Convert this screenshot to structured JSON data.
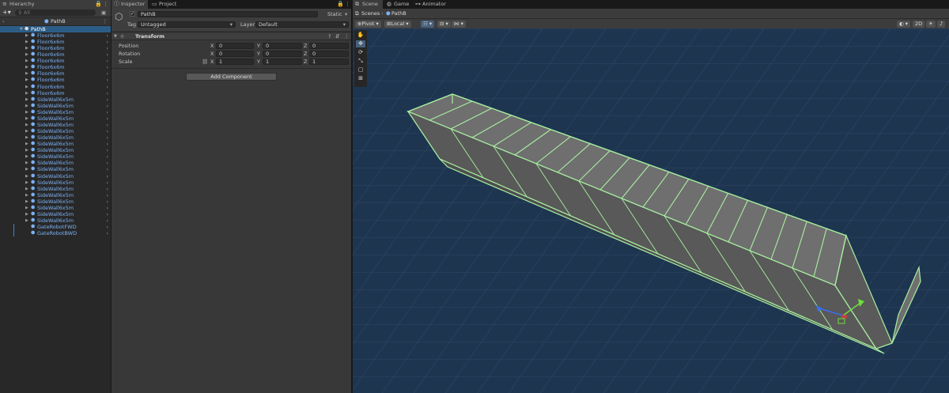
{
  "hierarchy": {
    "tab": "Hierarchy",
    "search_placeholder": "All",
    "scene_name": "PathB",
    "root": "PathB",
    "items": [
      "Floor6x6m",
      "Floor6x6m",
      "Floor6x6m",
      "Floor6x6m",
      "Floor6x6m",
      "Floor6x6m",
      "Floor6x6m",
      "Floor6x6m",
      "Floor6x6m",
      "Floor6x6m",
      "SideWall6x5m",
      "SideWall6x5m",
      "SideWall6x5m",
      "SideWall6x5m",
      "SideWall6x5m",
      "SideWall6x5m",
      "SideWall6x5m",
      "SideWall6x5m",
      "SideWall6x5m",
      "SideWall6x5m",
      "SideWall6x5m",
      "SideWall6x5m",
      "SideWall6x5m",
      "SideWall6x5m",
      "SideWall6x5m",
      "SideWall6x5m",
      "SideWall6x5m",
      "SideWall6x5m",
      "SideWall6x5m",
      "SideWall6x5m",
      "GateRobotFWD",
      "GateRobotBWD"
    ]
  },
  "inspector": {
    "tab": "Inspector",
    "tab2": "Project",
    "object_name": "PathB",
    "static_label": "Static",
    "tag_label": "Tag",
    "tag_value": "Untagged",
    "layer_label": "Layer",
    "layer_value": "Default",
    "component": "Transform",
    "position_label": "Position",
    "rotation_label": "Rotation",
    "scale_label": "Scale",
    "position": {
      "x": "0",
      "y": "0",
      "z": "0"
    },
    "rotation": {
      "x": "0",
      "y": "0",
      "z": "0"
    },
    "scale": {
      "x": "1",
      "y": "1",
      "z": "1"
    },
    "axis_x": "X",
    "axis_y": "Y",
    "axis_z": "Z",
    "add_component": "Add Component"
  },
  "scene": {
    "tab_scene": "Scene",
    "tab_game": "Game",
    "tab_animator": "Animator",
    "breadcrumb_root": "Scenes",
    "breadcrumb_item": "PathB",
    "pivot": "Pivot",
    "local": "Local",
    "mode_2d": "2D",
    "colors": {
      "background": "#1e3550",
      "wire": "#a8f0a0",
      "wall": "#6f6f6f"
    }
  }
}
